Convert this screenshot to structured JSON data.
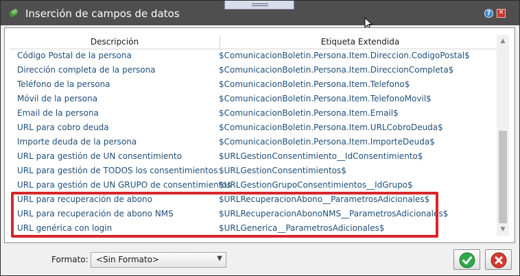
{
  "window": {
    "title": "Inserción de campos de datos",
    "help_label": "?",
    "close_label": "✕"
  },
  "table": {
    "columns": [
      "Descripción",
      "Etiqueta Extendida"
    ],
    "rows": [
      {
        "description": "Código Postal de la persona",
        "tag": "$ComunicacionBoletin.Persona.Item.Direccion.CodigoPostal$"
      },
      {
        "description": "Dirección completa de la persona",
        "tag": "$ComunicacionBoletin.Persona.Item.DireccionCompleta$"
      },
      {
        "description": "Teléfono de la persona",
        "tag": "$ComunicacionBoletin.Persona.Item.Telefono$"
      },
      {
        "description": "Móvil de la persona",
        "tag": "$ComunicacionBoletin.Persona.Item.TelefonoMovil$"
      },
      {
        "description": "Email de la persona",
        "tag": "$ComunicacionBoletin.Persona.Item.Email$"
      },
      {
        "description": "URL para cobro deuda",
        "tag": "$ComunicacionBoletin.Persona.Item.URLCobroDeuda$"
      },
      {
        "description": "Importe deuda de la persona",
        "tag": "$ComunicacionBoletin.Persona.Item.ImporteDeuda$"
      },
      {
        "description": "URL para gestión de UN consentimiento",
        "tag": "$URLGestionConsentimiento__IdConsentimiento$"
      },
      {
        "description": "URL para gestión de TODOS los consentimientos",
        "tag": "$URLGestionConsentimientos$"
      },
      {
        "description": "URL para gestión de UN GRUPO de consentimientos",
        "tag": "$URLGestionGrupoConsentimientos__IdGrupo$"
      },
      {
        "description": "URL para recuperación de abono",
        "tag": "$URLRecuperacionAbono__ParametrosAdicionales$"
      },
      {
        "description": "URL para recuperación de abono NMS",
        "tag": "$URLRecuperacionAbonoNMS__ParametrosAdicionales$"
      },
      {
        "description": "URL genérica con login",
        "tag": "$URLGenerica__ParametrosAdicionales$"
      }
    ]
  },
  "footer": {
    "format_label": "Formato:",
    "format_value": "<Sin Formato>"
  },
  "colors": {
    "titlebar": "#4f4f4f",
    "row_text": "#1f4e79",
    "highlight": "#d9242c",
    "ok_green": "#2fa84a",
    "cancel_red": "#d23a2e"
  }
}
